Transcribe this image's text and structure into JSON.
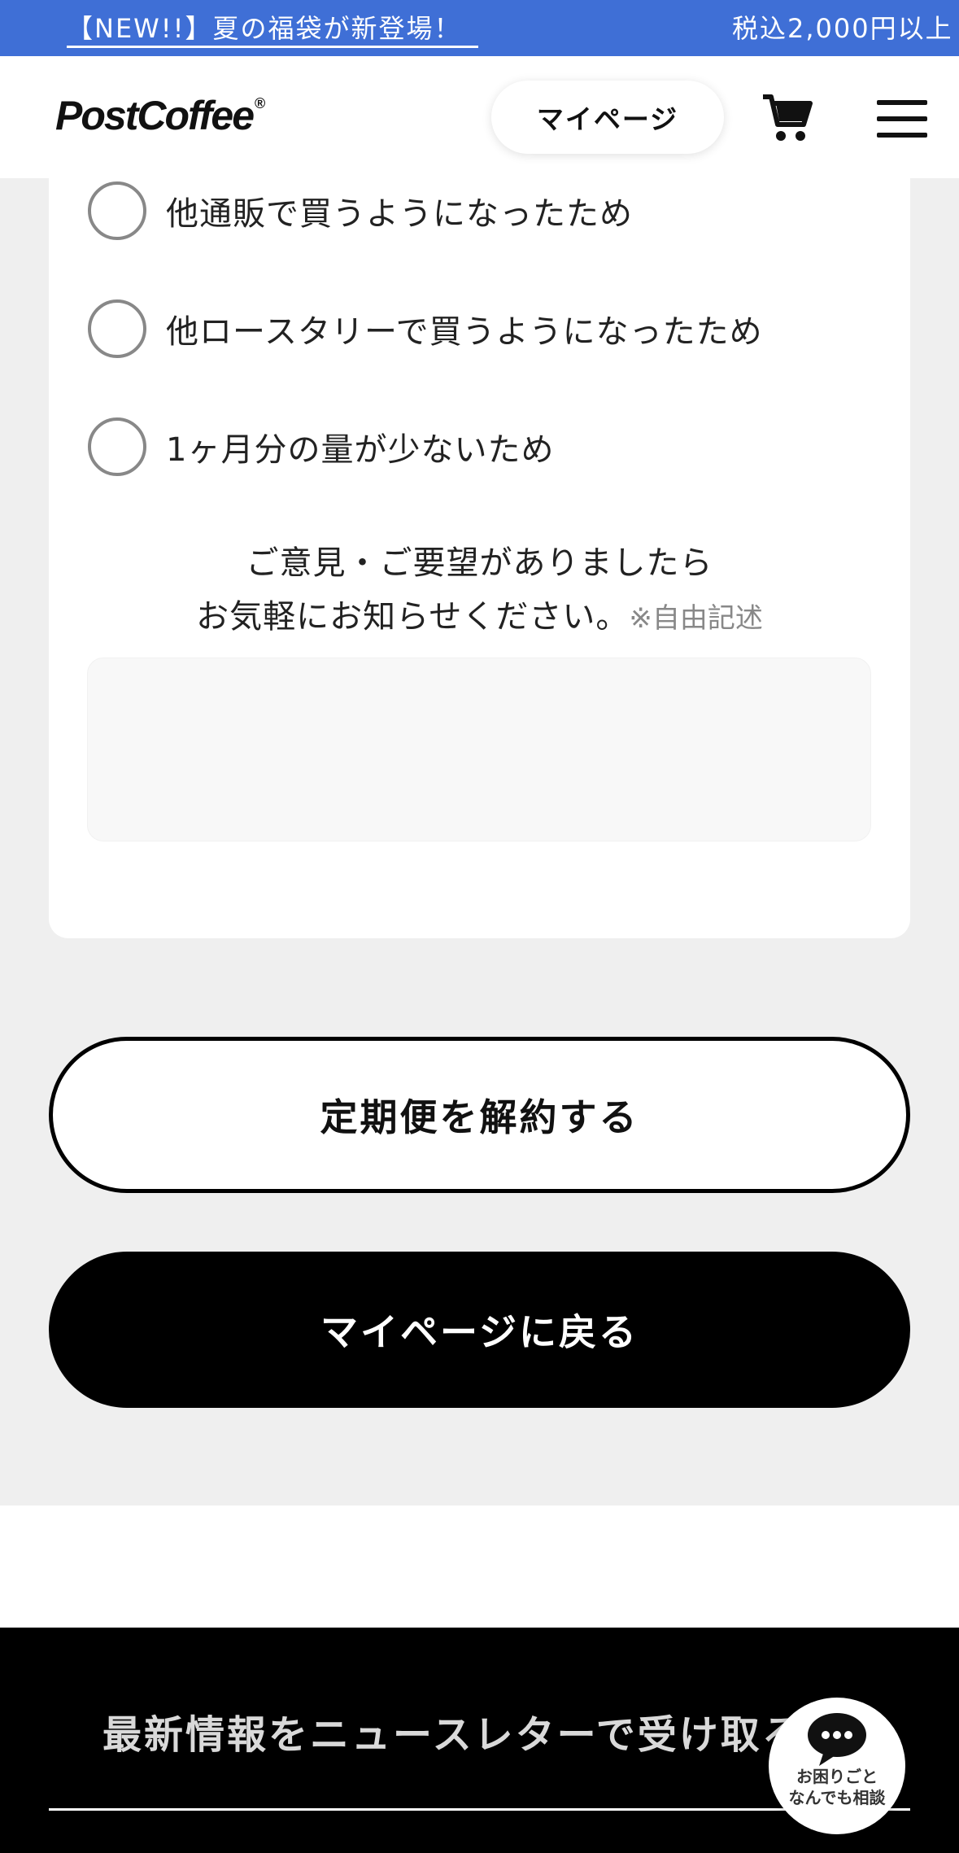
{
  "announcement": {
    "news_text": "【NEW!!】夏の福袋が新登場！",
    "shipping_text": "税込2,000円以上",
    "bg_color": "#3f6fd6"
  },
  "header": {
    "logo_text": "PostCoffee",
    "logo_mark": "®",
    "mypage_label": "マイページ",
    "cart_icon": "cart-icon",
    "menu_icon": "hamburger-menu-icon"
  },
  "survey": {
    "options": [
      {
        "label": "他通販で買うようになったため"
      },
      {
        "label": "他ロースタリーで買うようになったため"
      },
      {
        "label": "1ヶ月分の量が少ないため"
      }
    ],
    "prompt_line1": "ご意見・ご要望がありましたら",
    "prompt_line2": "お気軽にお知らせください。",
    "prompt_note": "※自由記述",
    "textarea_value": "",
    "textarea_placeholder": ""
  },
  "actions": {
    "cancel_label": "定期便を解約する",
    "back_label": "マイページに戻る"
  },
  "footer": {
    "newsletter_text": "最新情報をニュースレターで受け取る"
  },
  "help": {
    "line1": "お困りごと",
    "line2": "なんでも相談",
    "icon": "chat-bubble-icon"
  }
}
